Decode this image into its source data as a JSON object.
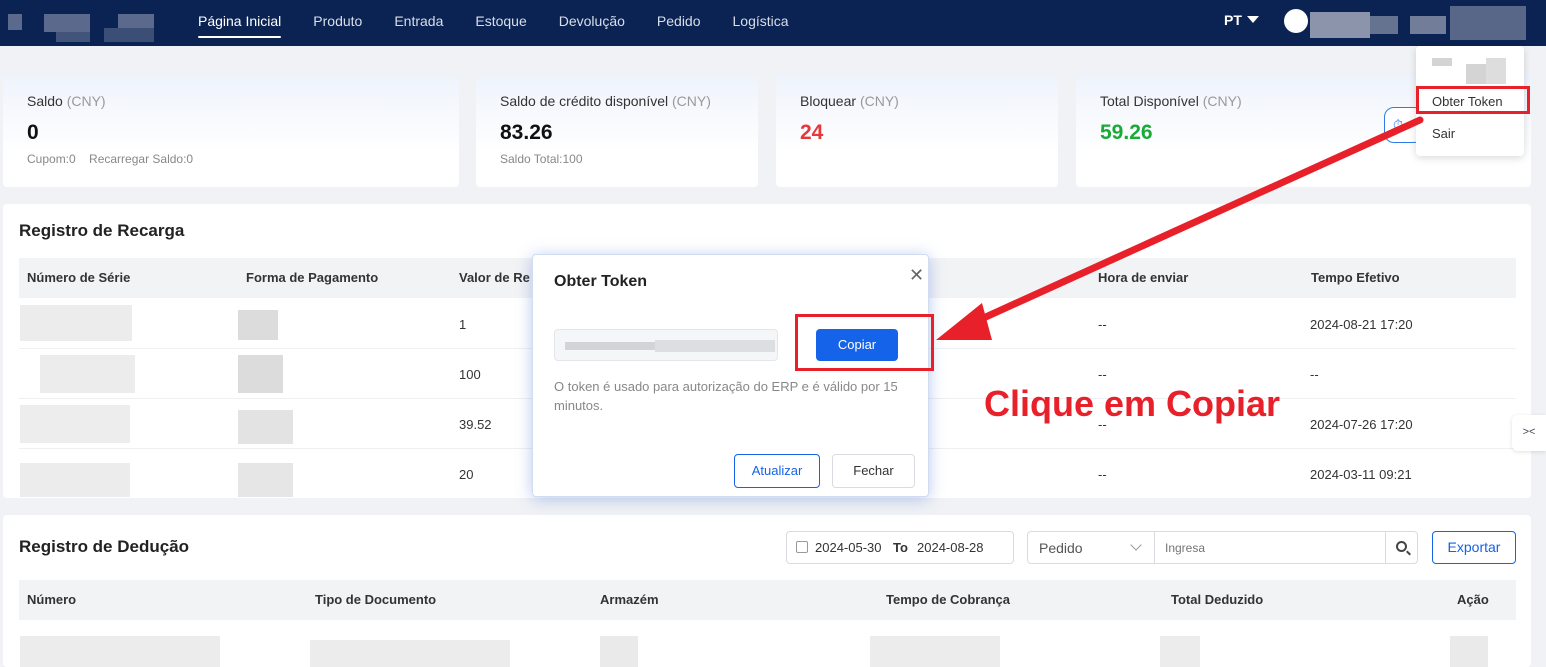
{
  "nav": {
    "items": [
      "Página Inicial",
      "Produto",
      "Entrada",
      "Estoque",
      "Devolução",
      "Pedido",
      "Logística"
    ],
    "active_index": 0
  },
  "header": {
    "lang": "PT"
  },
  "dropdown": {
    "items": [
      "Obter Token",
      "Sair"
    ]
  },
  "cards": [
    {
      "label": "Saldo",
      "unit": "(CNY)",
      "value": "0",
      "sub1": "Cupom:0",
      "sub2": "Recarregar Saldo:0"
    },
    {
      "label": "Saldo de crédito disponível",
      "unit": "(CNY)",
      "value": "83.26",
      "sub1": "Saldo Total:100"
    },
    {
      "label": "Bloquear",
      "unit": "(CNY)",
      "value": "24"
    },
    {
      "label": "Total Disponível",
      "unit": "(CNY)",
      "value": "59.26"
    }
  ],
  "recharge": {
    "title": "Registro de Recarga",
    "columns": [
      "Número de Série",
      "Forma de Pagamento",
      "Valor de Re",
      "Hora de enviar",
      "Tempo Efetivo"
    ],
    "rows": [
      {
        "value": "1",
        "sent": "--",
        "effective": "2024-08-21 17:20"
      },
      {
        "value": "100",
        "sent": "--",
        "effective": "--"
      },
      {
        "value": "39.52",
        "sent": "--",
        "effective": "2024-07-26 17:20"
      },
      {
        "value": "20",
        "sent": "--",
        "effective": "2024-03-11 09:21"
      }
    ]
  },
  "modal": {
    "title": "Obter Token",
    "copy_label": "Copiar",
    "note": "O token é usado para autorização do ERP e é válido por 15 minutos.",
    "refresh_label": "Atualizar",
    "close_label": "Fechar"
  },
  "annotation": "Clique em Copiar",
  "deduction": {
    "title": "Registro de Dedução",
    "date_from": "2024-05-30",
    "to_label": "To",
    "date_to": "2024-08-28",
    "select_value": "Pedido",
    "search_placeholder": "Ingresa",
    "export_label": "Exportar",
    "columns": [
      "Número",
      "Tipo de Documento",
      "Armazém",
      "Tempo de Cobrança",
      "Total Deduzido",
      "Ação"
    ]
  },
  "colors": {
    "header_bg": "#0b2353",
    "primary": "#1463e8",
    "annotation_red": "#e8202a",
    "locked_red": "#e8363a",
    "available_green": "#1aaa38"
  }
}
